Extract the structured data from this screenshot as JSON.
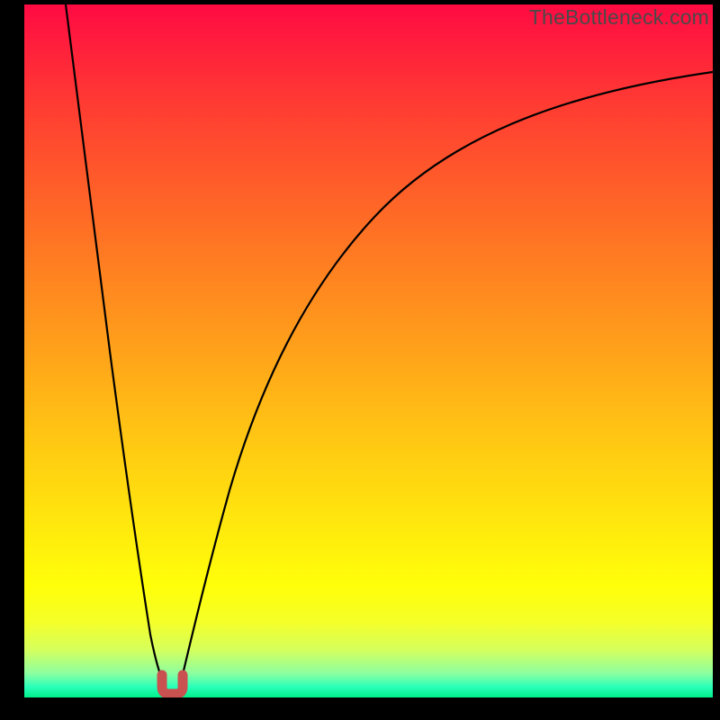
{
  "watermark": {
    "text": "TheBottleneck.com"
  },
  "chart_data": {
    "type": "line",
    "title": "",
    "xlabel": "",
    "ylabel": "",
    "xlim": [
      0,
      100
    ],
    "ylim": [
      0,
      100
    ],
    "grid": false,
    "legend": false,
    "series": [
      {
        "name": "bottleneck-curve-left",
        "x": [
          6,
          8,
          10,
          12,
          14,
          16,
          18,
          19.5,
          20.5
        ],
        "y": [
          100,
          87,
          73,
          59,
          44,
          29,
          14,
          4,
          1.5
        ]
      },
      {
        "name": "bottleneck-curve-right",
        "x": [
          22.5,
          24,
          26,
          29,
          33,
          38,
          44,
          51,
          59,
          68,
          78,
          89,
          100
        ],
        "y": [
          1.5,
          5,
          13,
          24,
          36,
          47,
          57,
          65,
          72,
          78,
          83,
          87,
          90
        ]
      },
      {
        "name": "min-marker",
        "marker": "u-shape",
        "color": "#c9514f",
        "x": [
          21.5
        ],
        "y": [
          1.0
        ]
      }
    ],
    "background_gradient": {
      "orientation": "vertical",
      "stops": [
        {
          "pos": 0.0,
          "color": "#ff0a42"
        },
        {
          "pos": 0.25,
          "color": "#ff5a2a"
        },
        {
          "pos": 0.5,
          "color": "#ffa21a"
        },
        {
          "pos": 0.75,
          "color": "#ffe80d"
        },
        {
          "pos": 0.93,
          "color": "#d7ff5b"
        },
        {
          "pos": 1.0,
          "color": "#00f08a"
        }
      ]
    }
  }
}
